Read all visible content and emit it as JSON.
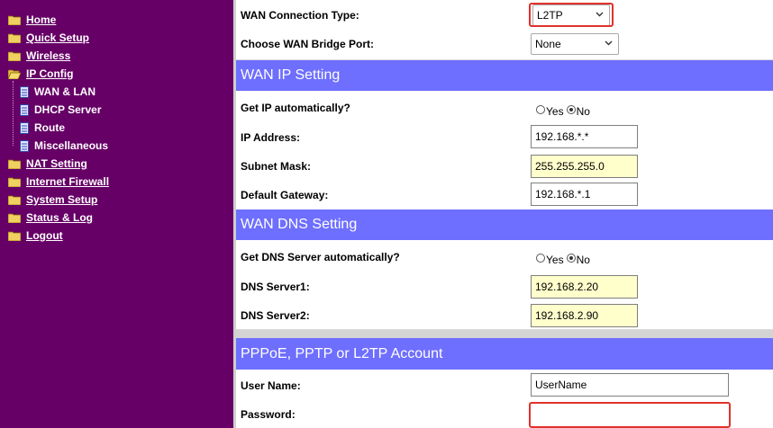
{
  "sidebar": {
    "items": [
      {
        "label": "Home",
        "type": "folder"
      },
      {
        "label": "Quick Setup",
        "type": "folder"
      },
      {
        "label": "Wireless",
        "type": "folder"
      },
      {
        "label": "IP Config",
        "type": "folder-open"
      },
      {
        "label": "WAN & LAN",
        "type": "page"
      },
      {
        "label": "DHCP Server",
        "type": "page"
      },
      {
        "label": "Route",
        "type": "page"
      },
      {
        "label": "Miscellaneous",
        "type": "page"
      },
      {
        "label": "NAT Setting",
        "type": "folder"
      },
      {
        "label": "Internet Firewall",
        "type": "folder"
      },
      {
        "label": "System Setup",
        "type": "folder"
      },
      {
        "label": "Status & Log",
        "type": "folder"
      },
      {
        "label": "Logout",
        "type": "folder"
      }
    ]
  },
  "form": {
    "wan_type_label": "WAN Connection Type:",
    "wan_type_value": "L2TP",
    "bridge_label": "Choose WAN Bridge Port:",
    "bridge_value": "None",
    "wan_ip_section": "WAN IP Setting",
    "get_ip_label": "Get IP automatically?",
    "get_ip_yes": "Yes",
    "get_ip_no": "No",
    "ip_label": "IP Address:",
    "ip_value": "192.168.*.*",
    "mask_label": "Subnet Mask:",
    "mask_value": "255.255.255.0",
    "gw_label": "Default Gateway:",
    "gw_value": "192.168.*.1",
    "dns_section": "WAN DNS Setting",
    "get_dns_label": "Get DNS Server automatically?",
    "get_dns_yes": "Yes",
    "get_dns_no": "No",
    "dns1_label": "DNS Server1:",
    "dns1_value": "192.168.2.20",
    "dns2_label": "DNS Server2:",
    "dns2_value": "192.168.2.90",
    "account_section": "PPPoE, PPTP or L2TP Account",
    "user_label": "User Name:",
    "user_value": "UserName",
    "pass_label": "Password:",
    "pass_value": ""
  },
  "colors": {
    "sidebar_bg": "#660066",
    "section_bg": "#6e6eff",
    "highlight": "#e0312b",
    "input_yellow": "#ffffcc"
  }
}
